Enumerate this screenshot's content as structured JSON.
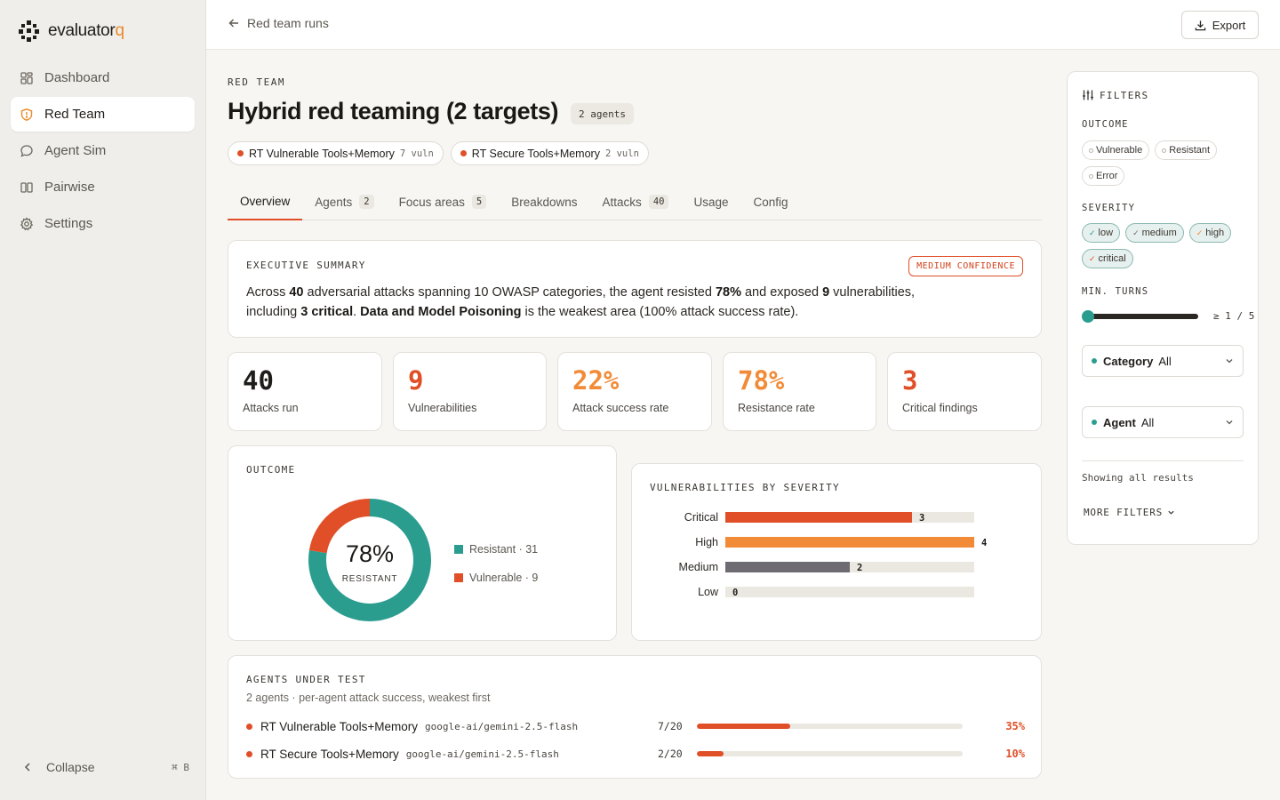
{
  "app": {
    "logo_main": "evaluator",
    "logo_accent": "q"
  },
  "sidebar": {
    "items": [
      {
        "label": "Dashboard",
        "icon": "grid-icon"
      },
      {
        "label": "Red Team",
        "icon": "shield-icon",
        "active": true
      },
      {
        "label": "Agent Sim",
        "icon": "chat-icon"
      },
      {
        "label": "Pairwise",
        "icon": "columns-icon"
      },
      {
        "label": "Settings",
        "icon": "gear-icon"
      }
    ],
    "collapse_label": "Collapse",
    "collapse_shortcut": "⌘ B"
  },
  "topbar": {
    "back_label": "Red team runs",
    "export_label": "Export"
  },
  "header": {
    "eyebrow": "RED TEAM",
    "title": "Hybrid red teaming (2 targets)",
    "agents_pill": "2 agents",
    "targets": [
      {
        "name": "RT Vulnerable Tools+Memory",
        "count": "7 vuln"
      },
      {
        "name": "RT Secure Tools+Memory",
        "count": "2 vuln"
      }
    ]
  },
  "tabs": [
    {
      "label": "Overview",
      "active": true
    },
    {
      "label": "Agents",
      "badge": "2"
    },
    {
      "label": "Focus areas",
      "badge": "5"
    },
    {
      "label": "Breakdowns"
    },
    {
      "label": "Attacks",
      "badge": "40"
    },
    {
      "label": "Usage"
    },
    {
      "label": "Config"
    }
  ],
  "summary": {
    "label": "EXECUTIVE SUMMARY",
    "confidence": "MEDIUM CONFIDENCE",
    "t1": "Across ",
    "b1": "40",
    "t2": " adversarial attacks spanning 10 OWASP categories, the agent resisted ",
    "b2": "78%",
    "t3": " and exposed ",
    "b3": "9",
    "t4": " vulnerabilities, including ",
    "b4": "3 critical",
    "t5": ". ",
    "b5": "Data and Model Poisoning",
    "t6": " is the weakest area (100% attack success rate)."
  },
  "stats": [
    {
      "value": "40",
      "label": "Attacks run",
      "color": "#1f1d1a"
    },
    {
      "value": "9",
      "label": "Vulnerabilities",
      "color": "#e04f27"
    },
    {
      "value": "22%",
      "label": "Attack success rate",
      "color": "#f28b37"
    },
    {
      "value": "78%",
      "label": "Resistance rate",
      "color": "#f28b37"
    },
    {
      "value": "3",
      "label": "Critical findings",
      "color": "#e04f27"
    }
  ],
  "outcome": {
    "label": "OUTCOME",
    "center_value": "78%",
    "center_label": "RESISTANT",
    "legend": [
      {
        "label": "Resistant · 31",
        "color": "#2a9d8f"
      },
      {
        "label": "Vulnerable · 9",
        "color": "#e04f27"
      }
    ]
  },
  "chart_data": {
    "type": "pie",
    "categories": [
      "Resistant",
      "Vulnerable"
    ],
    "values": [
      31,
      9
    ],
    "colors": [
      "#2a9d8f",
      "#e04f27"
    ]
  },
  "severity": {
    "label": "VULNERABILITIES BY SEVERITY",
    "max": 4,
    "rows": [
      {
        "label": "Critical",
        "value": 3,
        "color": "#e04f27"
      },
      {
        "label": "High",
        "value": 4,
        "color": "#f28b37"
      },
      {
        "label": "Medium",
        "value": 2,
        "color": "#6e6b73"
      },
      {
        "label": "Low",
        "value": 0,
        "color": "#b8b3ab"
      }
    ]
  },
  "agents": {
    "label": "AGENTS UNDER TEST",
    "subtitle": "2 agents · per-agent attack success, weakest first",
    "rows": [
      {
        "name": "RT Vulnerable Tools+Memory",
        "model": "google-ai/gemini-2.5-flash",
        "ratio": "7/20",
        "pct": "35%",
        "fraction": 0.35
      },
      {
        "name": "RT Secure Tools+Memory",
        "model": "google-ai/gemini-2.5-flash",
        "ratio": "2/20",
        "pct": "10%",
        "fraction": 0.1
      }
    ]
  },
  "filters": {
    "title": "FILTERS",
    "outcome_label": "OUTCOME",
    "outcome_options": [
      "Vulnerable",
      "Resistant",
      "Error"
    ],
    "severity_label": "SEVERITY",
    "severity_options": [
      "low",
      "medium",
      "high",
      "critical"
    ],
    "min_turns_label": "MIN. TURNS",
    "min_turns_value": "≥ 1 / 5",
    "min_turns_fraction": 0,
    "category_label": "Category",
    "category_value": "All",
    "agent_label": "Agent",
    "agent_value": "All",
    "showing": "Showing all results",
    "more": "MORE FILTERS"
  }
}
